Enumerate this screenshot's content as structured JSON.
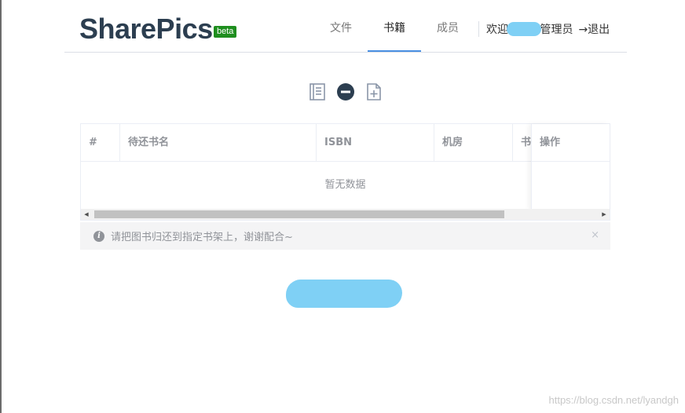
{
  "brand": {
    "name": "SharePics",
    "badge": "beta"
  },
  "nav": {
    "items": [
      {
        "label": "文件"
      },
      {
        "label": "书籍"
      },
      {
        "label": "成员"
      }
    ],
    "active": "书籍"
  },
  "user": {
    "greeting": "欢迎,",
    "role": "管理员",
    "logout": "→退出"
  },
  "toolbar": {
    "icons": [
      "book-list-icon",
      "minus-circle-icon",
      "add-file-icon"
    ]
  },
  "table": {
    "columns": [
      "#",
      "待还书名",
      "ISBN",
      "机房",
      "书",
      "操作"
    ],
    "empty_text": "暂无数据"
  },
  "alert": {
    "text": "请把图书归还到指定书架上，谢谢配合~",
    "close": "×"
  },
  "watermark": "https://blog.csdn.net/lyandgh",
  "colors": {
    "brand": "#2c3e50",
    "badge": "#1e8e1e",
    "accent": "#4a90e2",
    "redaction": "#7fd0f5"
  }
}
